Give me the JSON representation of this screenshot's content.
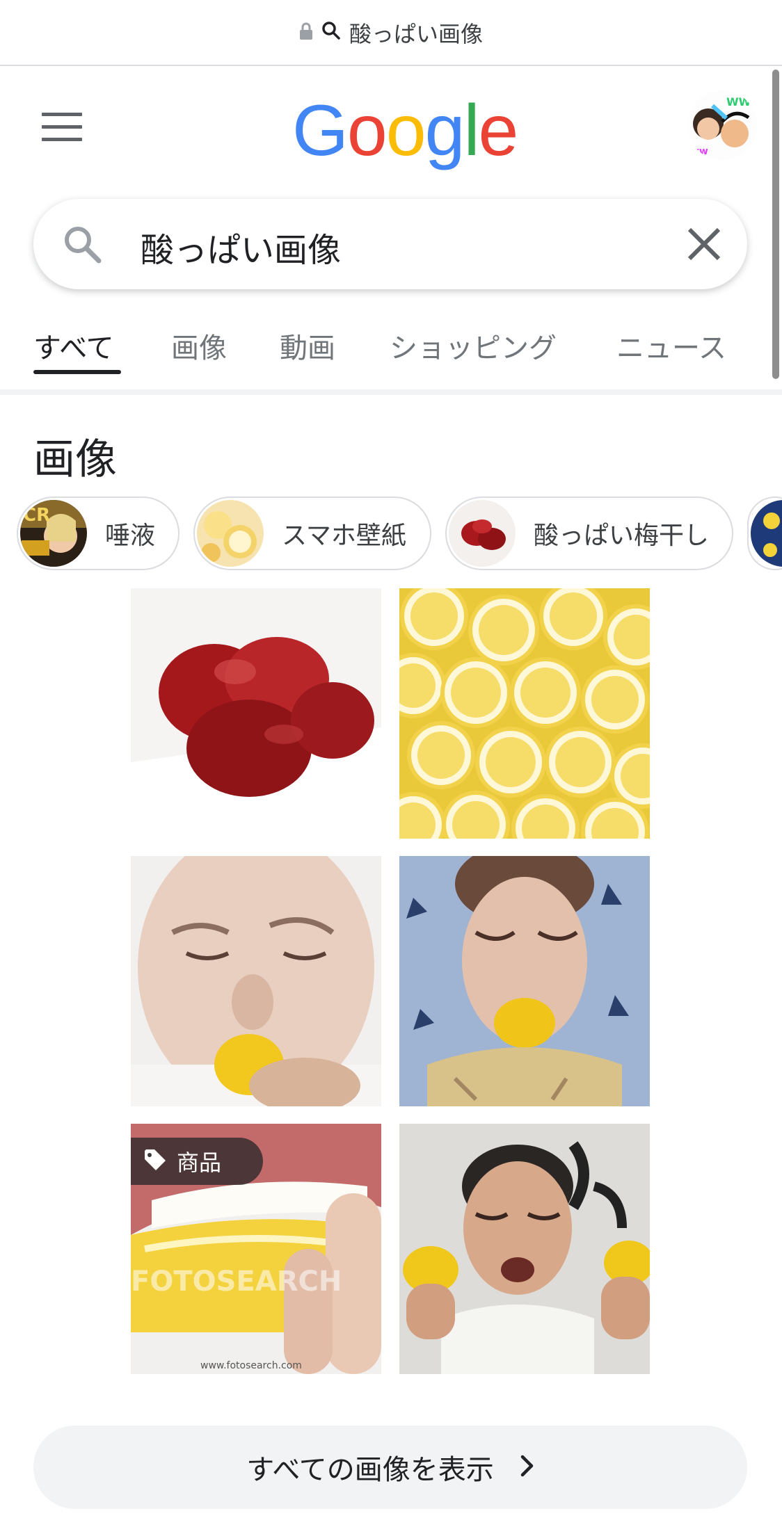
{
  "url_bar": {
    "text": "酸っぱい画像"
  },
  "header": {
    "logo_text": "Google"
  },
  "search": {
    "query": "酸っぱい画像"
  },
  "tabs": [
    {
      "label": "すべて",
      "active": true
    },
    {
      "label": "画像"
    },
    {
      "label": "動画"
    },
    {
      "label": "ショッピング"
    },
    {
      "label": "ニュース"
    }
  ],
  "images_section": {
    "title": "画像",
    "chips": [
      {
        "label": "唾液"
      },
      {
        "label": "スマホ壁紙"
      },
      {
        "label": "酸っぱい梅干し"
      }
    ],
    "product_badge": "商品",
    "show_all": "すべての画像を表示"
  },
  "colors": {
    "google_blue": "#4285F4",
    "google_red": "#EA4335",
    "google_yellow": "#FBBC05",
    "google_green": "#34A853"
  }
}
